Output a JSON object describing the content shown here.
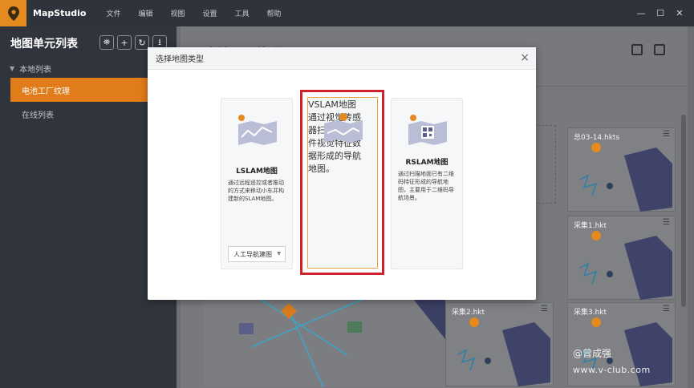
{
  "app": {
    "name": "MapStudio",
    "menu": [
      "文件",
      "编辑",
      "视图",
      "设置",
      "工具",
      "帮助"
    ],
    "window_controls": [
      "—",
      "☐",
      "✕"
    ]
  },
  "sidebar": {
    "title": "地图单元列表",
    "tools": [
      "⛯",
      "+",
      "↻",
      "⭳"
    ],
    "group_local": "本地列表",
    "active_item": "电池工厂纹理",
    "group_online": "在线列表"
  },
  "main": {
    "title": "电池工厂纹理",
    "cards": [
      {
        "title": "总03-14.hkts"
      },
      {
        "title": "采集1.hkt"
      },
      {
        "title": "采集2.hkt"
      },
      {
        "title": "采集3.hkt"
      }
    ]
  },
  "modal": {
    "title": "选择地图类型",
    "close": "×",
    "types": {
      "lslam": {
        "title": "LSLAM地图",
        "desc": "通过远程遥控或者推动的方式来移动小车并构建新的SLAM地图。",
        "select_value": "人工导航建图"
      },
      "vslam": {
        "title": "VSLAM地图",
        "desc": "通过视觉传感器扫描出的控件视觉特征数据形成的导航地图。"
      },
      "rslam": {
        "title": "RSLAM地图",
        "desc": "通过扫描地面已有二维码特征形成的导航地图，主要用于二维码导航场景。"
      }
    }
  },
  "watermark": {
    "line1": "@曾成强",
    "line2": "www.v-club.com"
  },
  "colors": {
    "accent": "#e07d1a",
    "selection": "#d0202a",
    "sidebar_bg": "#30343c"
  }
}
